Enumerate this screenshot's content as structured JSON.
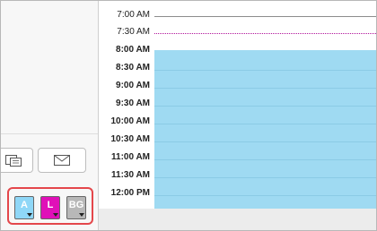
{
  "left_panel": {
    "copy_button": {
      "icon": "copy-icon"
    },
    "mail_button": {
      "icon": "envelope-icon"
    },
    "filters": [
      {
        "label": "A",
        "color": "#8fd7f7"
      },
      {
        "label": "L",
        "color": "#e010b8"
      },
      {
        "label": "BG",
        "color": "#b8b8b8"
      }
    ],
    "highlight_color": "#e4474b"
  },
  "calendar": {
    "event_color": "#9fdaf2",
    "times": [
      "7:00 AM",
      "7:30 AM",
      "8:00 AM",
      "8:30 AM",
      "9:00 AM",
      "9:30 AM",
      "10:00 AM",
      "10:30 AM",
      "11:00 AM",
      "11:30 AM",
      "12:00 PM"
    ]
  }
}
